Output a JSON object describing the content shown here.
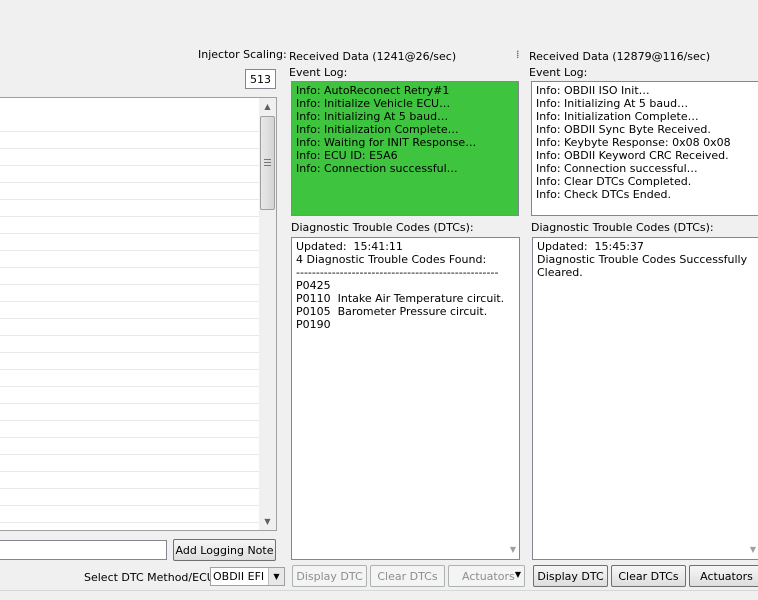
{
  "injector": {
    "label": "Injector Scaling:",
    "value": "513"
  },
  "panel1": {
    "received": "Received Data (1241@26/sec)",
    "event_log_label": "Event Log:",
    "event_log": [
      "Info: AutoReconect Retry#1",
      "Info: Initialize Vehicle ECU…",
      "Info: Initializing At 5 baud…",
      "Info: Initialization Complete…",
      "Info: Waiting for INIT Response…",
      "Info: ECU ID: E5A6",
      "Info: Connection successful…"
    ],
    "dtc_label": "Diagnostic Trouble Codes (DTCs):",
    "dtc_lines": [
      "Updated:  15:41:11",
      "4 Diagnostic Trouble Codes Found:",
      "---------------------------------------------------",
      "P0425",
      "P0110  Intake Air Temperature circuit.",
      "P0105  Barometer Pressure circuit.",
      "P0190"
    ],
    "buttons": {
      "display": "Display DTC",
      "clear": "Clear DTCs",
      "actuators": "Actuators"
    }
  },
  "panel2": {
    "received": "Received Data (12879@116/sec)",
    "event_log_label": "Event Log:",
    "event_log": [
      "Info: OBDII ISO Init…",
      "Info: Initializing At 5 baud…",
      "Info: Initialization Complete…",
      "Info: OBDII Sync Byte Received.",
      "Info: Keybyte Response: 0x08 0x08",
      "Info: OBDII Keyword CRC Received.",
      "Info: Connection successful…",
      "Info: Clear DTCs Completed.",
      "Info: Check DTCs Ended."
    ],
    "dtc_label": "Diagnostic Trouble Codes (DTCs):",
    "dtc_lines": [
      "Updated:  15:45:37",
      "Diagnostic Trouble Codes Successfully",
      "Cleared."
    ],
    "buttons": {
      "display": "Display DTC",
      "clear": "Clear DTCs",
      "actuators": "Actuators"
    }
  },
  "logging": {
    "add_note": "Add Logging Note",
    "note_value": ""
  },
  "dtc_method": {
    "label": "Select DTC Method/ECU:",
    "selected": "OBDII EFI"
  },
  "colors": {
    "active_log": "#3ec43e",
    "border": "#828790"
  }
}
